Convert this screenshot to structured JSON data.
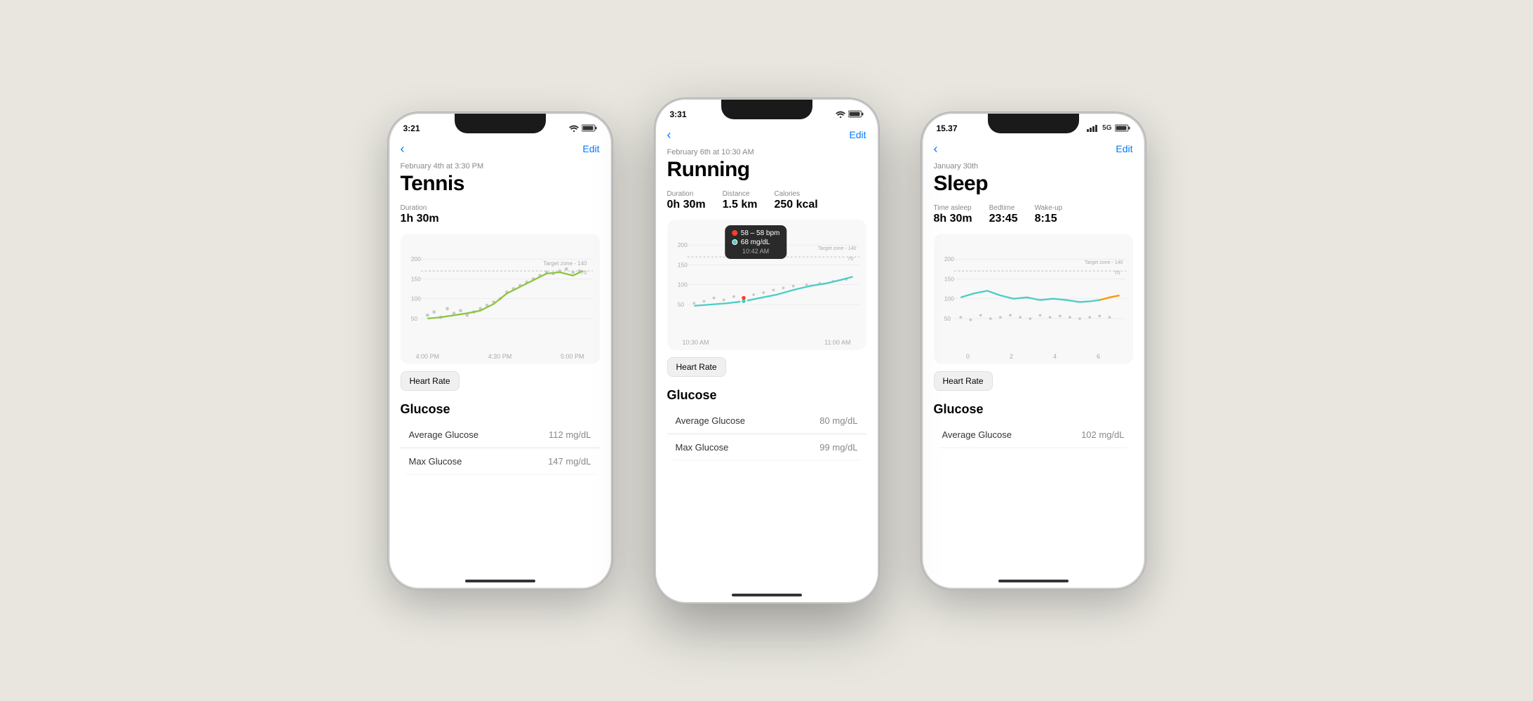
{
  "background_color": "#e8e6df",
  "phones": [
    {
      "id": "tennis",
      "status_bar": {
        "time": "3:21",
        "icons": "WiFi Battery"
      },
      "nav": {
        "back_label": "‹",
        "edit_label": "Edit"
      },
      "workout_date": "February 4th at 3:30 PM",
      "workout_title": "Tennis",
      "stats": [
        {
          "label": "Duration",
          "value": "1h 30m"
        }
      ],
      "chart": {
        "y_labels": [
          "200",
          "150",
          "100",
          "50"
        ],
        "x_labels": [
          "4:00 PM",
          "4:30 PM",
          "5:00 PM"
        ],
        "target_zone": "Target zone - 140",
        "line_color": "#8dc63f",
        "dot_color": "#c0c0c0"
      },
      "heart_rate_button": "Heart Rate",
      "sections": [
        {
          "title": "Glucose",
          "rows": [
            {
              "label": "Average Glucose",
              "value": "112 mg/dL"
            },
            {
              "label": "Max Glucose",
              "value": "147 mg/dL"
            }
          ]
        }
      ]
    },
    {
      "id": "running",
      "status_bar": {
        "time": "3:31",
        "icons": "WiFi Battery"
      },
      "nav": {
        "back_label": "‹",
        "edit_label": "Edit"
      },
      "workout_date": "February 6th at 10:30 AM",
      "workout_title": "Running",
      "stats": [
        {
          "label": "Duration",
          "value": "0h 30m"
        },
        {
          "label": "Distance",
          "value": "1.5 km"
        },
        {
          "label": "Calories",
          "value": "250 kcal"
        }
      ],
      "chart": {
        "y_labels": [
          "200",
          "150",
          "100",
          "50"
        ],
        "x_labels": [
          "10:30 AM",
          "11:00 AM"
        ],
        "target_zone": "Target zone - 140",
        "line_color": "#4ecdc4",
        "dot_color": "#c0c0c0"
      },
      "tooltip": {
        "line1": "58 – 58 bpm",
        "line2": "68 mg/dL",
        "time": "10:42 AM",
        "dot1_color": "#ff3b30",
        "dot2_color": "#4ecdc4"
      },
      "heart_rate_button": "Heart Rate",
      "sections": [
        {
          "title": "Glucose",
          "rows": [
            {
              "label": "Average Glucose",
              "value": "80 mg/dL"
            },
            {
              "label": "Max Glucose",
              "value": "99 mg/dL"
            }
          ]
        }
      ]
    },
    {
      "id": "sleep",
      "status_bar": {
        "time": "15.37",
        "icons": "Signal 5G Battery"
      },
      "nav": {
        "back_label": "‹",
        "edit_label": "Edit"
      },
      "workout_date": "January 30th",
      "workout_title": "Sleep",
      "stats": [
        {
          "label": "Time asleep",
          "value": "8h 30m"
        },
        {
          "label": "Bedtime",
          "value": "23:45"
        },
        {
          "label": "Wake-up",
          "value": "8:15"
        }
      ],
      "chart": {
        "y_labels": [
          "200",
          "150",
          "100",
          "50"
        ],
        "x_labels": [
          "0",
          "2",
          "4",
          "6"
        ],
        "target_zone": "Target zone - 140",
        "line_color": "#4ecdc4",
        "dot_color": "#c0c0c0",
        "line_color2": "#ff9500"
      },
      "heart_rate_button": "Heart Rate",
      "sections": [
        {
          "title": "Glucose",
          "rows": [
            {
              "label": "Average Glucose",
              "value": "102 mg/dL"
            }
          ]
        }
      ]
    }
  ]
}
